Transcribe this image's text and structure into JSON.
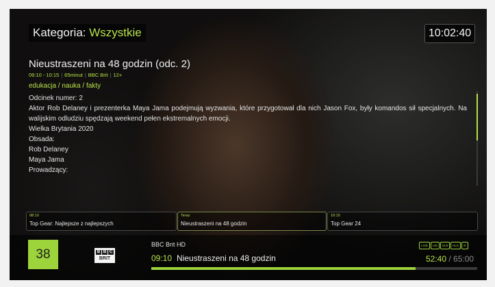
{
  "header": {
    "category_label": "Kategoria:",
    "category_value": "Wszystkie",
    "clock": "10:02:40"
  },
  "program": {
    "title": "Nieustraszeni na 48 godzin (odc. 2)",
    "meta": [
      "09:10 - 10:15",
      "65minut",
      "BBC Brit",
      "12+"
    ],
    "genre": "edukacja / nauka / fakty",
    "episode": "Odcinek numer: 2",
    "description": "Aktor Rob Delaney i prezenterka Maya Jama podejmują wyzwania, które przygotował dla nich Jason Fox, były komandos sił specjalnych. Na walijskim odludziu spędzają weekend pełen ekstremalnych emocji.",
    "country_year": "Wielka Brytania 2020",
    "cast_label": "Obsada:",
    "cast": [
      "Rob Delaney",
      "Maya Jama"
    ],
    "hosts_label": "Prowadzący:"
  },
  "epg": [
    {
      "time": "08:10",
      "name": "Top Gear: Najlepsze z najlepszych"
    },
    {
      "time": "Teraz",
      "name": "Nieustraszeni na 48 godzin"
    },
    {
      "time": "10:15",
      "name": "Top Gear 24"
    }
  ],
  "channel": {
    "number": "38",
    "logo": {
      "letters": [
        "B",
        "B",
        "C"
      ],
      "sub": "BRIT"
    },
    "name": "BBC Brit HD",
    "now_time": "09:10",
    "now_title": "Nieustraszeni na 48 godzin",
    "badges": [
      "LIVE",
      "HD",
      "16:9",
      "HLS",
      "R"
    ],
    "elapsed": "52:40",
    "total": "/ 65:00",
    "progress_fraction": 0.81
  },
  "colors": {
    "accent": "#b6e24a",
    "channel_box": "#9dd43c"
  }
}
